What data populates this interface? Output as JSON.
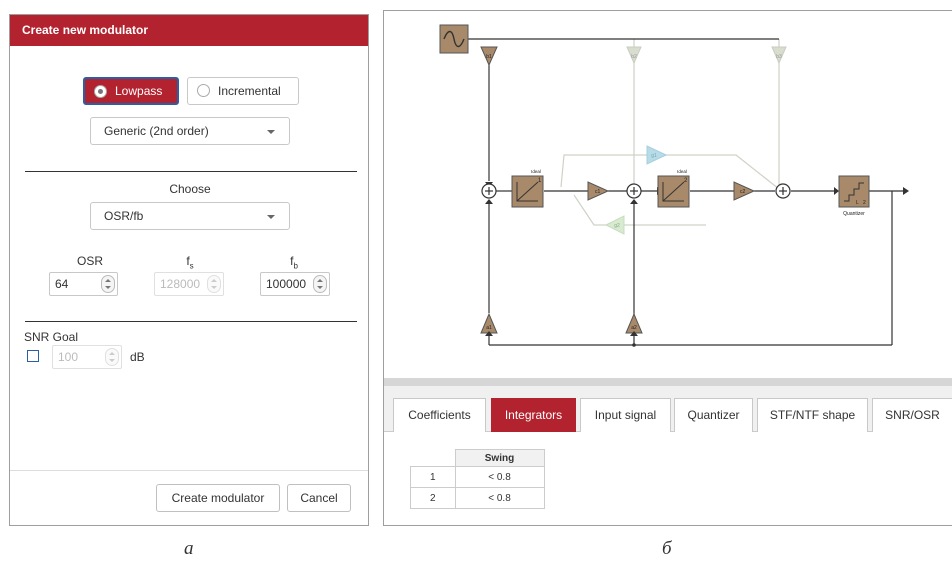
{
  "dialog": {
    "title": "Create new modulator",
    "filter_types": [
      {
        "label": "Lowpass",
        "selected": true
      },
      {
        "label": "Incremental",
        "selected": false
      }
    ],
    "order_select": "Generic (2nd order)",
    "choose_label": "Choose",
    "param_select": "OSR/fb",
    "params": {
      "osr": {
        "label": "OSR",
        "value": "64",
        "enabled": true
      },
      "fs": {
        "label": "f",
        "sub": "s",
        "value": "128000",
        "enabled": false
      },
      "fb": {
        "label": "f",
        "sub": "b",
        "value": "100000",
        "enabled": true
      }
    },
    "snr": {
      "label": "SNR Goal",
      "value": "100",
      "unit": "dB",
      "checked": false
    },
    "buttons": {
      "create": "Create modulator",
      "cancel": "Cancel"
    }
  },
  "diagram": {
    "labels": {
      "b1": "b1",
      "b2": "b2",
      "b3": "b3",
      "c1": "c1",
      "c2": "c2",
      "a1": "a1",
      "a2": "a2",
      "g1": "g1",
      "g2": "g2",
      "int1_top": "Ideal",
      "int1_num": "1",
      "int2_top": "Ideal",
      "int2_num": "2",
      "quantizer": "Quantizer",
      "quantizer_L": "L",
      "quantizer_num": "2"
    }
  },
  "tabs": [
    "Coefficients",
    "Integrators",
    "Input signal",
    "Quantizer",
    "STF/NTF shape",
    "SNR/OSR"
  ],
  "active_tab": "Integrators",
  "swing_table": {
    "header": "Swing",
    "rows": [
      {
        "index": "1",
        "value": "< 0.8"
      },
      {
        "index": "2",
        "value": "< 0.8"
      }
    ]
  },
  "captions": {
    "left": "а",
    "right": "б"
  },
  "colors": {
    "accent": "#b3232f",
    "block": "#a88a6a",
    "faded": "#d8ddd0",
    "faded_blue": "#b7dbe8"
  }
}
